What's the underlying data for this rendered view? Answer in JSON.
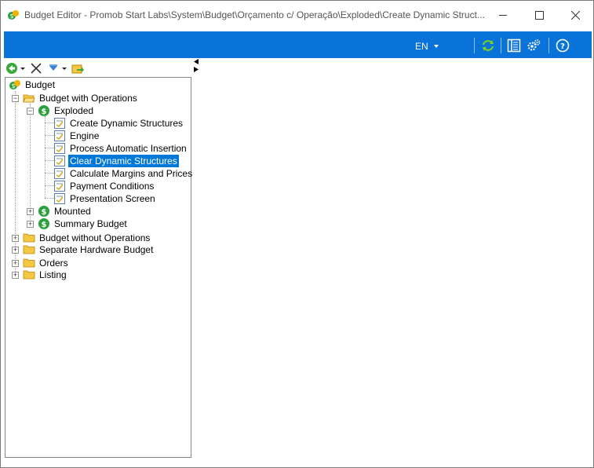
{
  "window": {
    "title": "Budget Editor - Promob Start Labs\\System\\Budget\\Orçamento c/ Operação\\Exploded\\Create Dynamic Struct..."
  },
  "toolbar": {
    "language": "EN",
    "icons": [
      "refresh-icon",
      "panel-layout-icon",
      "settings-gears-icon",
      "help-icon"
    ]
  },
  "left_toolbar": {
    "icons": [
      "back-icon",
      "delete-icon",
      "dropdown-icon",
      "export-icon"
    ]
  },
  "colors": {
    "accent_blue": "#0a73d9",
    "selection": "#0078d7",
    "folder_yellow": "#f5c842",
    "money_green": "#2e9e3f"
  },
  "tree": {
    "root": "Budget",
    "budget_with_operations": "Budget with Operations",
    "exploded": "Exploded",
    "exploded_items": [
      "Create Dynamic Structures",
      "Engine",
      "Process Automatic Insertion",
      "Clear Dynamic Structures",
      "Calculate Margins and Prices",
      "Payment Conditions",
      "Presentation Screen"
    ],
    "mounted": "Mounted",
    "summary_budget": "Summary Budget",
    "budget_without_operations": "Budget without Operations",
    "separate_hardware_budget": "Separate Hardware Budget",
    "orders": "Orders",
    "listing": "Listing",
    "selected_item": "Clear Dynamic Structures"
  }
}
